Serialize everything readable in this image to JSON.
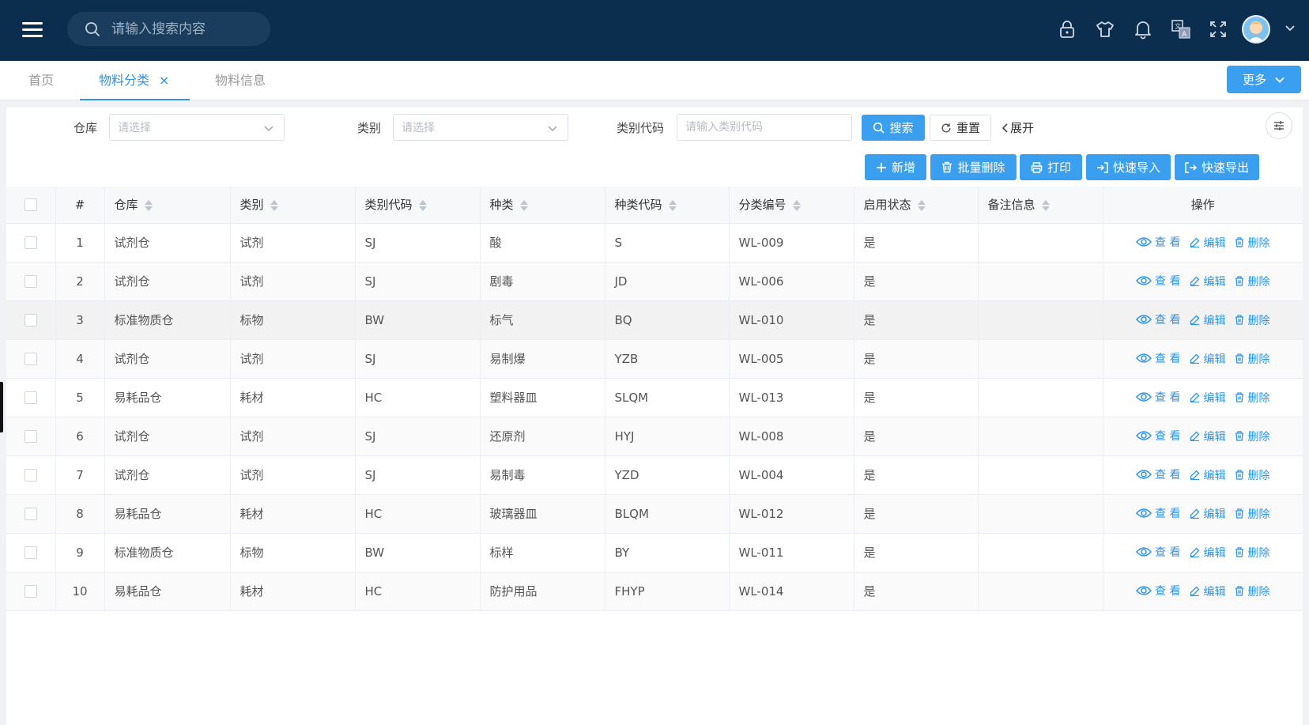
{
  "header": {
    "search_placeholder": "请输入搜索内容",
    "icons": [
      "lock-icon",
      "shirt-icon",
      "bell-icon",
      "translate-icon",
      "fullscreen-icon"
    ]
  },
  "tabs": [
    {
      "label": "首页",
      "active": false
    },
    {
      "label": "物料分类",
      "active": true,
      "close": "×"
    },
    {
      "label": "物料信息",
      "active": false
    }
  ],
  "more_label": "更多",
  "filters": {
    "warehouse_label": "仓库",
    "warehouse_placeholder": "请选择",
    "category_label": "类别",
    "category_placeholder": "请选择",
    "code_label": "类别代码",
    "code_placeholder": "请输入类别代码",
    "search_label": "搜索",
    "reset_label": "重置",
    "expand_label": "展开"
  },
  "toolbar": {
    "add_label": "新增",
    "batch_delete_label": "批量删除",
    "print_label": "打印",
    "import_label": "快速导入",
    "export_label": "快速导出"
  },
  "table": {
    "columns": [
      "#",
      "仓库",
      "类别",
      "类别代码",
      "种类",
      "种类代码",
      "分类编号",
      "启用状态",
      "备注信息",
      "操作"
    ],
    "ops": {
      "view": "查 看",
      "edit": "编辑",
      "delete": "删除"
    },
    "rows": [
      {
        "idx": "1",
        "warehouse": "试剂仓",
        "category": "试剂",
        "cat_code": "SJ",
        "kind": "酸",
        "kind_code": "S",
        "class_no": "WL-009",
        "enabled": "是",
        "remark": ""
      },
      {
        "idx": "2",
        "warehouse": "试剂仓",
        "category": "试剂",
        "cat_code": "SJ",
        "kind": "剧毒",
        "kind_code": "JD",
        "class_no": "WL-006",
        "enabled": "是",
        "remark": ""
      },
      {
        "idx": "3",
        "warehouse": "标准物质仓",
        "category": "标物",
        "cat_code": "BW",
        "kind": "标气",
        "kind_code": "BQ",
        "class_no": "WL-010",
        "enabled": "是",
        "remark": ""
      },
      {
        "idx": "4",
        "warehouse": "试剂仓",
        "category": "试剂",
        "cat_code": "SJ",
        "kind": "易制爆",
        "kind_code": "YZB",
        "class_no": "WL-005",
        "enabled": "是",
        "remark": ""
      },
      {
        "idx": "5",
        "warehouse": "易耗品仓",
        "category": "耗材",
        "cat_code": "HC",
        "kind": "塑料器皿",
        "kind_code": "SLQM",
        "class_no": "WL-013",
        "enabled": "是",
        "remark": ""
      },
      {
        "idx": "6",
        "warehouse": "试剂仓",
        "category": "试剂",
        "cat_code": "SJ",
        "kind": "还原剂",
        "kind_code": "HYJ",
        "class_no": "WL-008",
        "enabled": "是",
        "remark": ""
      },
      {
        "idx": "7",
        "warehouse": "试剂仓",
        "category": "试剂",
        "cat_code": "SJ",
        "kind": "易制毒",
        "kind_code": "YZD",
        "class_no": "WL-004",
        "enabled": "是",
        "remark": ""
      },
      {
        "idx": "8",
        "warehouse": "易耗品仓",
        "category": "耗材",
        "cat_code": "HC",
        "kind": "玻璃器皿",
        "kind_code": "BLQM",
        "class_no": "WL-012",
        "enabled": "是",
        "remark": ""
      },
      {
        "idx": "9",
        "warehouse": "标准物质仓",
        "category": "标物",
        "cat_code": "BW",
        "kind": "标样",
        "kind_code": "BY",
        "class_no": "WL-011",
        "enabled": "是",
        "remark": ""
      },
      {
        "idx": "10",
        "warehouse": "易耗品仓",
        "category": "耗材",
        "cat_code": "HC",
        "kind": "防护用品",
        "kind_code": "FHYP",
        "class_no": "WL-014",
        "enabled": "是",
        "remark": ""
      }
    ]
  },
  "colors": {
    "header_bg": "#0b2e4f",
    "primary": "#3b9ff0",
    "link": "#2e94e8"
  }
}
